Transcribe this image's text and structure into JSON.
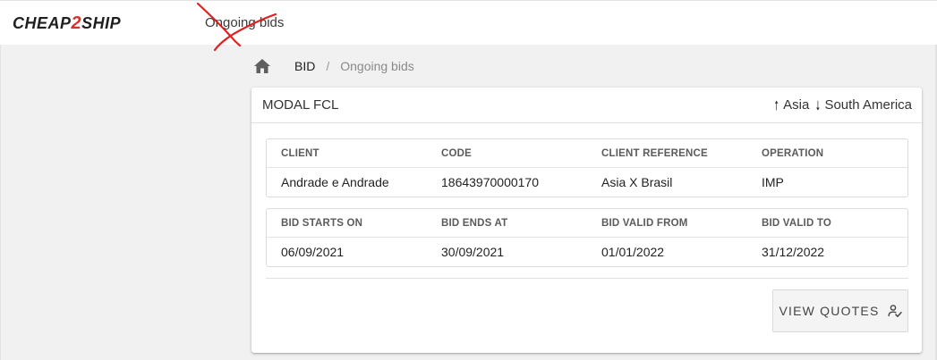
{
  "header": {
    "logo_text_left": "CHEAP",
    "logo_text_two": "2",
    "logo_text_right": "SHIP",
    "page_title": "Ongoing bids"
  },
  "breadcrumb": {
    "home_icon": "home-icon",
    "item": "BID",
    "separator": "/",
    "current": "Ongoing bids"
  },
  "card": {
    "title": "MODAL FCL",
    "route": {
      "origin_icon": "arrow-up-icon",
      "origin": "Asia",
      "destination_icon": "arrow-down-icon",
      "destination": "South America"
    },
    "details": {
      "headers": [
        "CLIENT",
        "CODE",
        "CLIENT REFERENCE",
        "OPERATION"
      ],
      "values": [
        "Andrade e Andrade",
        "18643970000170",
        "Asia X Brasil",
        "IMP"
      ]
    },
    "dates": {
      "headers": [
        "BID STARTS ON",
        "BID ENDS AT",
        "BID VALID FROM",
        "BID VALID TO"
      ],
      "values": [
        "06/09/2021",
        "30/09/2021",
        "01/01/2022",
        "31/12/2022"
      ]
    },
    "action": {
      "label": "VIEW QUOTES",
      "icon": "person-check-icon"
    }
  },
  "colors": {
    "logo_accent": "#d6322b",
    "scribble": "#e02020",
    "background": "#f1f1f1",
    "card": "#ffffff"
  }
}
